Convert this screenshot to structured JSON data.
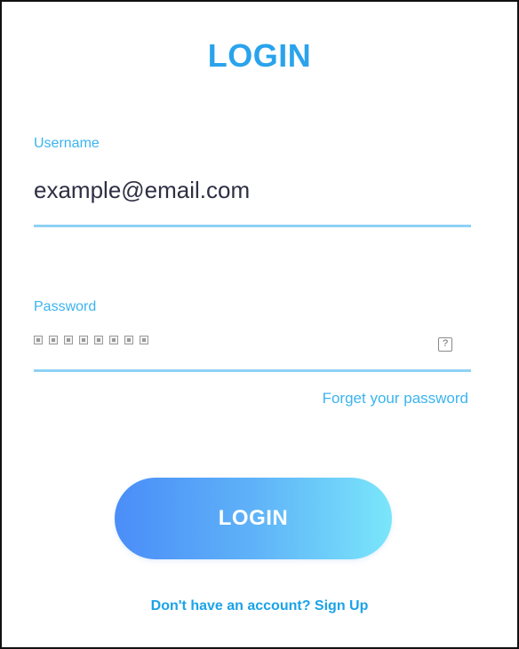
{
  "title": "LOGIN",
  "username": {
    "label": "Username",
    "value": "example@email.com"
  },
  "password": {
    "label": "Password",
    "masked_char_count": 8,
    "toggle_icon": "help-icon"
  },
  "forgot_password": "Forget your password",
  "login_button": "LOGIN",
  "signup": {
    "prompt": "Don't have an account?",
    "link": "Sign Up"
  },
  "colors": {
    "accent": "#2aa3ec",
    "label": "#3bb4ef",
    "underline": "#8fd2f6",
    "button_gradient_start": "#4a8df8",
    "button_gradient_end": "#7ae6fa"
  }
}
